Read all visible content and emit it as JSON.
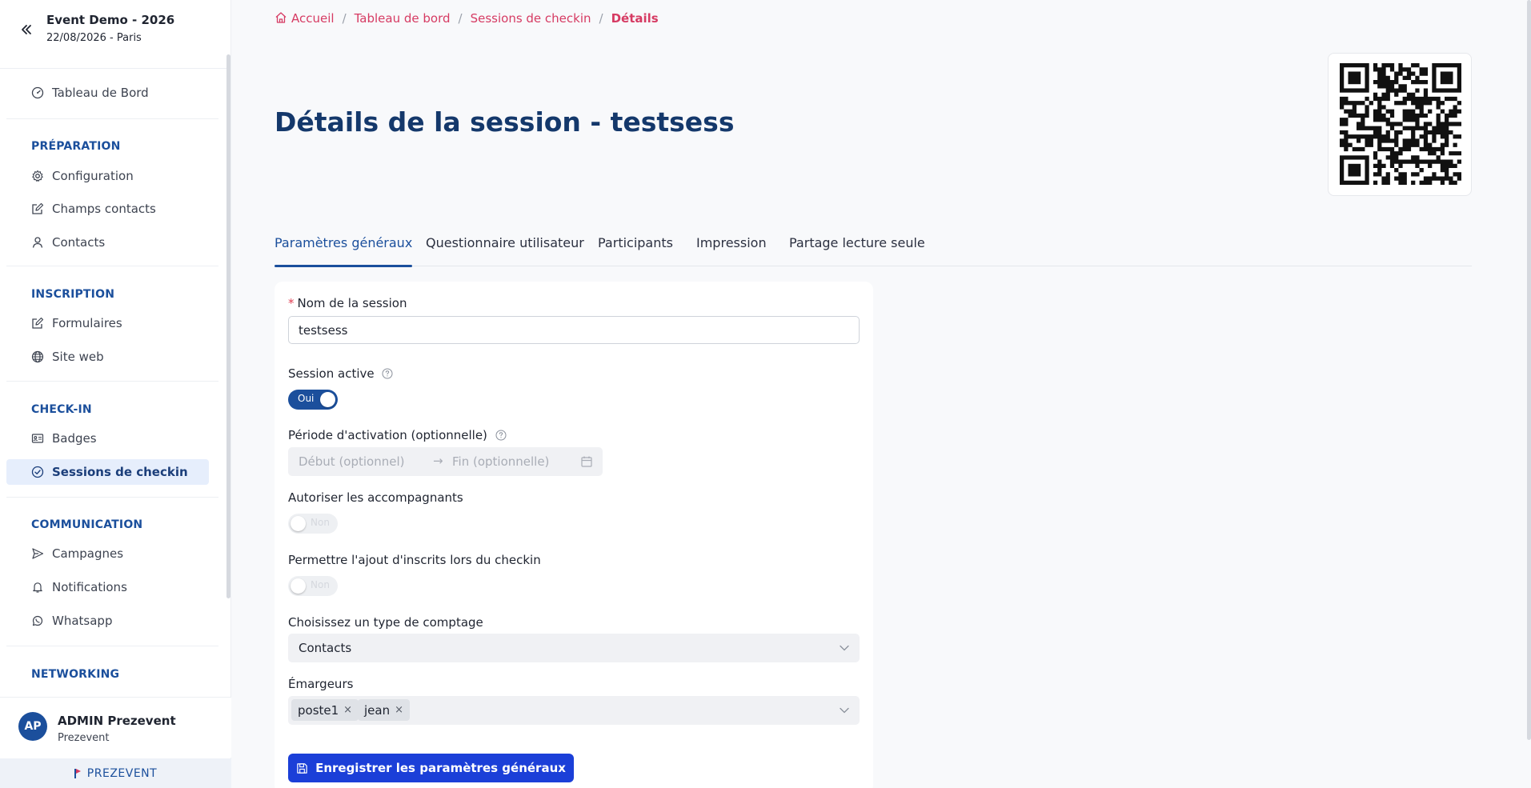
{
  "event": {
    "title": "Event Demo - 2026",
    "subtitle": "22/08/2026 - Paris"
  },
  "sidebar": {
    "dashboard": "Tableau de Bord",
    "sections": {
      "preparation": "PRÉPARATION",
      "inscription": "INSCRIPTION",
      "checkin": "CHECK-IN",
      "communication": "COMMUNICATION",
      "networking": "NETWORKING"
    },
    "items": {
      "configuration": "Configuration",
      "champs_contacts": "Champs contacts",
      "contacts": "Contacts",
      "formulaires": "Formulaires",
      "site_web": "Site web",
      "badges": "Badges",
      "sessions_checkin": "Sessions de checkin",
      "campagnes": "Campagnes",
      "notifications": "Notifications",
      "whatsapp": "Whatsapp"
    }
  },
  "user": {
    "initials": "AP",
    "name": "ADMIN Prezevent",
    "org": "Prezevent"
  },
  "brand": "PREZEVENT",
  "breadcrumb": {
    "home": "Accueil",
    "dashboard": "Tableau de bord",
    "sessions": "Sessions de checkin",
    "current": "Détails"
  },
  "page": {
    "title": "Détails de la session - testsess"
  },
  "tabs": {
    "general": "Paramètres généraux",
    "questionnaire": "Questionnaire utilisateur",
    "participants": "Participants",
    "impression": "Impression",
    "partage": "Partage lecture seule"
  },
  "form": {
    "name_required_mark": "*",
    "name_label": "Nom de la session",
    "name_value": "testsess",
    "active_label": "Session active",
    "active_toggle": "Oui",
    "period_label": "Période d'activation (optionnelle)",
    "period_start_placeholder": "Début (optionnel)",
    "period_arrow": "→",
    "period_end_placeholder": "Fin (optionnelle)",
    "companions_label": "Autoriser les accompagnants",
    "companions_toggle": "Non",
    "add_registrants_label": "Permettre l'ajout d'inscrits lors du checkin",
    "add_registrants_toggle": "Non",
    "count_type_label": "Choisissez un type de comptage",
    "count_type_value": "Contacts",
    "emargeurs_label": "Émargeurs",
    "emargeurs_tags": [
      "poste1",
      "jean"
    ],
    "tag_remove": "×",
    "save_button": "Enregistrer les paramètres généraux"
  },
  "colors": {
    "primary": "#1b4f9c",
    "accent": "#d63b63",
    "button": "#1b3fd8",
    "title": "#14386b"
  }
}
